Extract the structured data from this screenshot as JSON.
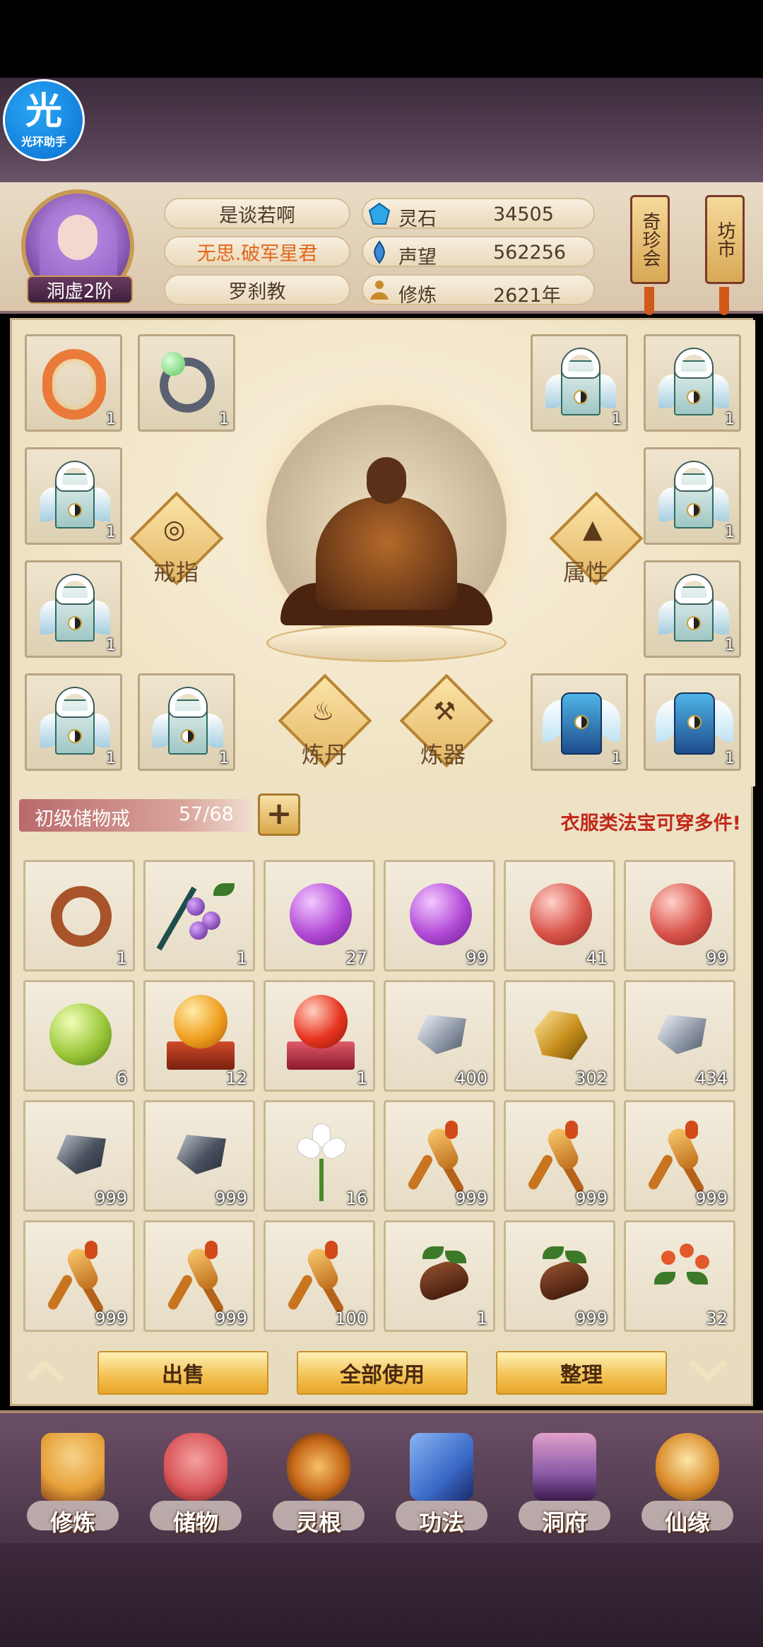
{
  "helper": {
    "glyph": "光",
    "label": "光环助手"
  },
  "player": {
    "name": "是谈若啊",
    "title": "无思.破军星君",
    "sect": "罗刹教",
    "rank": "洞虚2阶"
  },
  "stats": [
    {
      "label": "灵石",
      "value": "34505",
      "icon": "spirit-stone-icon",
      "color": "#2ea6e8"
    },
    {
      "label": "声望",
      "value": "562256",
      "icon": "prestige-icon",
      "color": "#3a8ad8"
    },
    {
      "label": "修炼",
      "value": "2621年",
      "icon": "cultivation-icon",
      "color": "#c98a2a"
    }
  ],
  "scroll_buttons": [
    {
      "label": "奇珍会"
    },
    {
      "label": "坊市"
    }
  ],
  "equipment": {
    "slots": [
      {
        "item": "dragon",
        "count": "1"
      },
      {
        "item": "ring",
        "count": "1"
      },
      {
        "item": "robe",
        "count": "1"
      },
      {
        "item": "robe",
        "count": "1"
      },
      {
        "item": "robe",
        "count": "1"
      },
      {
        "item": "robe",
        "count": "1"
      },
      {
        "item": "robe",
        "count": "1"
      },
      {
        "item": "robe",
        "count": "1"
      },
      {
        "item": "robe",
        "count": "1"
      },
      {
        "item": "robe",
        "count": "1"
      },
      {
        "item": "armor",
        "count": "1"
      },
      {
        "item": "armor",
        "count": "1"
      }
    ],
    "functions": [
      {
        "label": "戒指",
        "icon": "ring-icon"
      },
      {
        "label": "属性",
        "icon": "attribute-icon"
      },
      {
        "label": "炼丹",
        "icon": "cauldron-icon"
      },
      {
        "label": "炼器",
        "icon": "anvil-icon"
      }
    ]
  },
  "bag": {
    "name": "初级储物戒",
    "capacity": "57/68",
    "plus": "+",
    "hint": "衣服类法宝可穿多件!"
  },
  "inventory": [
    {
      "item": "ring",
      "count": "1"
    },
    {
      "item": "berry",
      "count": "1"
    },
    {
      "item": "orb-purple",
      "count": "27"
    },
    {
      "item": "orb-purple",
      "count": "99"
    },
    {
      "item": "orb-red",
      "count": "41"
    },
    {
      "item": "orb-red",
      "count": "99"
    },
    {
      "item": "orb-green",
      "count": "6"
    },
    {
      "item": "orb-orange-stand",
      "count": "12"
    },
    {
      "item": "orb-red-stand",
      "count": "1"
    },
    {
      "item": "stone-silver",
      "count": "400"
    },
    {
      "item": "gold-ore",
      "count": "302"
    },
    {
      "item": "stone-silver",
      "count": "434"
    },
    {
      "item": "stone-dark",
      "count": "999"
    },
    {
      "item": "stone-dark",
      "count": "999"
    },
    {
      "item": "white-flower",
      "count": "16"
    },
    {
      "item": "ginseng",
      "count": "999"
    },
    {
      "item": "ginseng",
      "count": "999"
    },
    {
      "item": "ginseng",
      "count": "999"
    },
    {
      "item": "ginseng",
      "count": "999"
    },
    {
      "item": "ginseng",
      "count": "999"
    },
    {
      "item": "ginseng",
      "count": "100"
    },
    {
      "item": "tuber",
      "count": "1"
    },
    {
      "item": "tuber",
      "count": "999"
    },
    {
      "item": "herb-buds",
      "count": "32"
    }
  ],
  "actions": {
    "sell": "出售",
    "use_all": "全部使用",
    "sort": "整理"
  },
  "nav": [
    {
      "label": "修炼",
      "color": "#e7a23a"
    },
    {
      "label": "储物",
      "color": "#d9565a"
    },
    {
      "label": "灵根",
      "color": "#c76a1a"
    },
    {
      "label": "功法",
      "color": "#3a6ac8"
    },
    {
      "label": "洞府",
      "color": "#8a5aa8"
    },
    {
      "label": "仙缘",
      "color": "#d98a2a"
    }
  ]
}
